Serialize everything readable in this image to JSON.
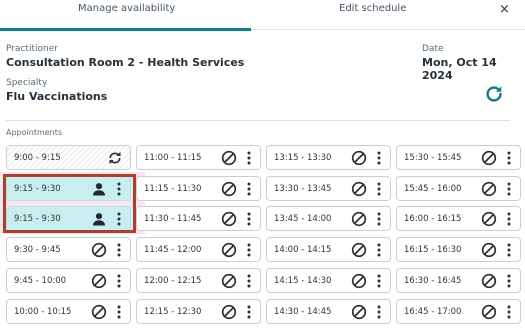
{
  "tabs": [
    {
      "label": "Manage availability",
      "active": true
    },
    {
      "label": "Edit schedule",
      "active": false
    }
  ],
  "close_symbol": "×",
  "practitioner": {
    "label": "Practitioner",
    "value": "Consultation Room 2 - Health Services"
  },
  "date": {
    "label": "Date",
    "value": "Mon, Oct 14 2024"
  },
  "specialty": {
    "label": "Specialty",
    "value": "Flu Vaccinations"
  },
  "appointments_label": "Appointments",
  "colors": {
    "accent": "#0b7f83",
    "booked": "#c8eef0",
    "highlight": "#a8402a"
  },
  "columns": [
    [
      {
        "time": "9:00 - 9:15",
        "status": "past",
        "icon": "refresh-icon"
      },
      {
        "time": "9:15 - 9:30",
        "status": "booked",
        "icon": "person-icon"
      },
      {
        "time": "9:15 - 9:30",
        "status": "booked",
        "icon": "person-icon"
      },
      {
        "time": "9:30 - 9:45",
        "status": "open",
        "icon": "block-icon"
      },
      {
        "time": "9:45 - 10:00",
        "status": "open",
        "icon": "block-icon"
      },
      {
        "time": "10:00 - 10:15",
        "status": "open",
        "icon": "block-icon"
      }
    ],
    [
      {
        "time": "11:00 - 11:15",
        "status": "open",
        "icon": "block-icon"
      },
      {
        "time": "11:15 - 11:30",
        "status": "open",
        "icon": "block-icon"
      },
      {
        "time": "11:30 - 11:45",
        "status": "open",
        "icon": "block-icon"
      },
      {
        "time": "11:45 - 12:00",
        "status": "open",
        "icon": "block-icon"
      },
      {
        "time": "12:00 - 12:15",
        "status": "open",
        "icon": "block-icon"
      },
      {
        "time": "12:15 - 12:30",
        "status": "open",
        "icon": "block-icon"
      }
    ],
    [
      {
        "time": "13:15 - 13:30",
        "status": "open",
        "icon": "block-icon"
      },
      {
        "time": "13:30 - 13:45",
        "status": "open",
        "icon": "block-icon"
      },
      {
        "time": "13:45 - 14:00",
        "status": "open",
        "icon": "block-icon"
      },
      {
        "time": "14:00 - 14:15",
        "status": "open",
        "icon": "block-icon"
      },
      {
        "time": "14:15 - 14:30",
        "status": "open",
        "icon": "block-icon"
      },
      {
        "time": "14:30 - 14:45",
        "status": "open",
        "icon": "block-icon"
      }
    ],
    [
      {
        "time": "15:30 - 15:45",
        "status": "open",
        "icon": "block-icon"
      },
      {
        "time": "15:45 - 16:00",
        "status": "open",
        "icon": "block-icon"
      },
      {
        "time": "16:00 - 16:15",
        "status": "open",
        "icon": "block-icon"
      },
      {
        "time": "16:15 - 16:30",
        "status": "open",
        "icon": "block-icon"
      },
      {
        "time": "16:30 - 16:45",
        "status": "open",
        "icon": "block-icon"
      },
      {
        "time": "16:45 - 17:00",
        "status": "open",
        "icon": "block-icon"
      }
    ]
  ]
}
